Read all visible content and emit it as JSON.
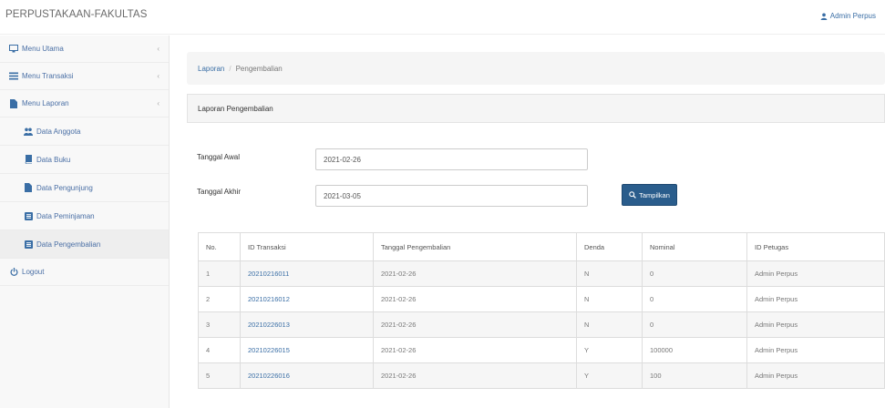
{
  "header": {
    "brand": "PERPUSTAKAAN-FAKULTAS",
    "user": "Admin Perpus",
    "user_icon": "user-icon"
  },
  "sidebar": {
    "items": [
      {
        "label": "Menu Utama",
        "icon": "desktop-icon",
        "chevron": "‹"
      },
      {
        "label": "Menu Transaksi",
        "icon": "list-icon",
        "chevron": "‹"
      },
      {
        "label": "Menu Laporan",
        "icon": "file-icon",
        "chevron": "‹"
      },
      {
        "label": "Data Anggota",
        "icon": "users-icon"
      },
      {
        "label": "Data Buku",
        "icon": "book-icon"
      },
      {
        "label": "Data Pengunjung",
        "icon": "file-icon"
      },
      {
        "label": "Data Peminjaman",
        "icon": "list-alt-icon"
      },
      {
        "label": "Data Pengembalian",
        "icon": "list-alt-icon"
      },
      {
        "label": "Logout",
        "icon": "power-icon"
      }
    ]
  },
  "breadcrumb": {
    "root": "Laporan",
    "current": "Pengembalian"
  },
  "panel": {
    "title": "Laporan Pengembalian"
  },
  "form": {
    "start_label": "Tanggal Awal",
    "start_value": "2021-02-26",
    "end_label": "Tanggal Akhir",
    "end_value": "2021-03-05",
    "submit_label": "Tampilkan",
    "submit_icon": "search-icon"
  },
  "colors": {
    "accent": "#2a5d8c",
    "link": "#3a6ea5"
  },
  "table": {
    "headers": [
      "No.",
      "ID Transaksi",
      "Tanggal Pengembalian",
      "Denda",
      "Nominal",
      "ID Petugas"
    ],
    "rows": [
      [
        "1",
        "20210216011",
        "2021-02-26",
        "N",
        "0",
        "Admin Perpus"
      ],
      [
        "2",
        "20210216012",
        "2021-02-26",
        "N",
        "0",
        "Admin Perpus"
      ],
      [
        "3",
        "20210226013",
        "2021-02-26",
        "N",
        "0",
        "Admin Perpus"
      ],
      [
        "4",
        "20210226015",
        "2021-02-26",
        "Y",
        "100000",
        "Admin Perpus"
      ],
      [
        "5",
        "20210226016",
        "2021-02-26",
        "Y",
        "100",
        "Admin Perpus"
      ]
    ]
  }
}
